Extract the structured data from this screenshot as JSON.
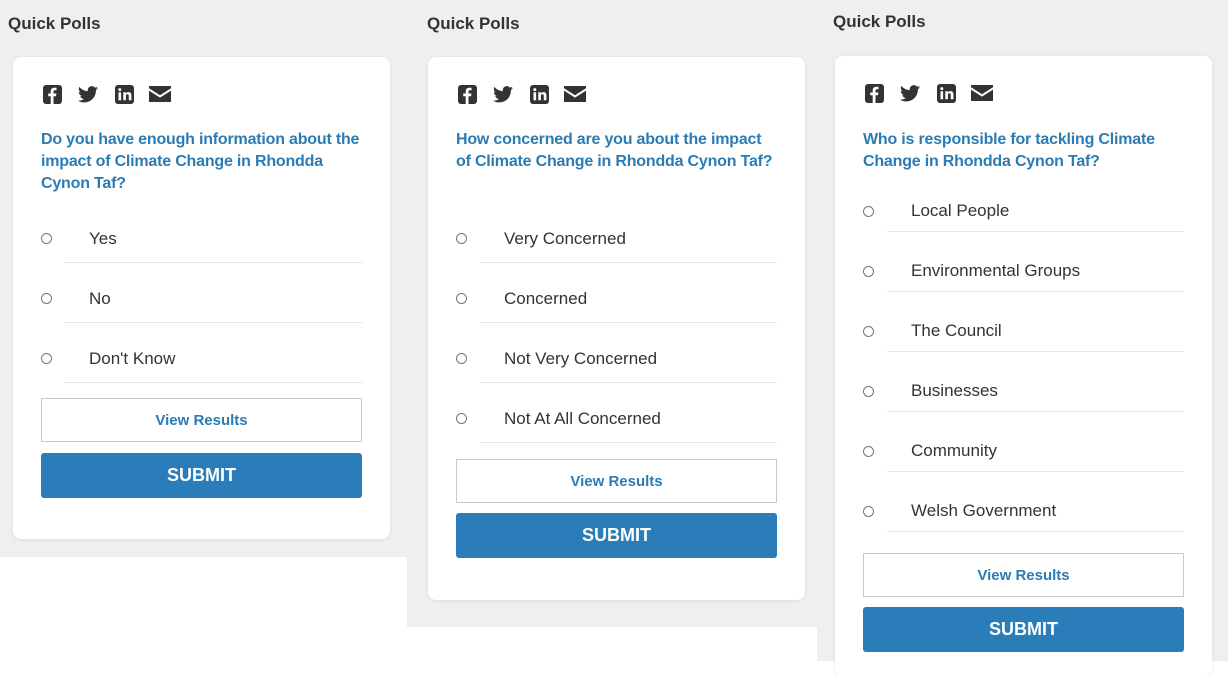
{
  "colors": {
    "panel_background": "#efefef",
    "question_text": "#2b7bb5",
    "submit_button": "#2a7db8",
    "icon": "#333333"
  },
  "share_icons": [
    "facebook-icon",
    "twitter-icon",
    "linkedin-icon",
    "email-icon"
  ],
  "polls": [
    {
      "heading": "Quick Polls",
      "question": "Do you have enough information about the impact of Climate Change in Rhondda Cynon Taf?",
      "options": [
        "Yes",
        "No",
        "Don't Know"
      ],
      "view_results_label": "View Results",
      "submit_label": "SUBMIT"
    },
    {
      "heading": "Quick Polls",
      "question": "How concerned are you about the impact of Climate Change in Rhondda Cynon Taf?",
      "options": [
        "Very Concerned",
        "Concerned",
        "Not Very Concerned",
        "Not At All Concerned"
      ],
      "view_results_label": "View Results",
      "submit_label": "SUBMIT"
    },
    {
      "heading": "Quick Polls",
      "question": "Who is responsible for tackling Climate Change in Rhondda Cynon Taf?",
      "options": [
        "Local People",
        "Environmental Groups",
        "The Council",
        "Businesses",
        "Community",
        "Welsh Government"
      ],
      "view_results_label": "View Results",
      "submit_label": "SUBMIT"
    }
  ]
}
